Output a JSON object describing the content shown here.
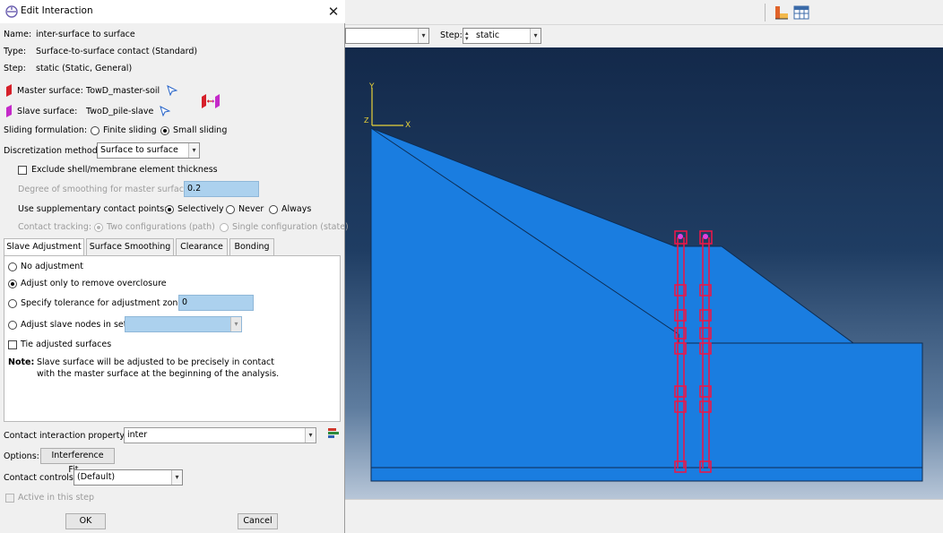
{
  "dialog": {
    "title": "Edit Interaction",
    "name_label": "Name:",
    "name_value": "inter-surface to surface",
    "type_label": "Type:",
    "type_value": "Surface-to-surface contact (Standard)",
    "step_label": "Step:",
    "step_value": "static (Static, General)",
    "master_label": "Master surface:",
    "master_value": "TowD_master-soil",
    "slave_label": "Slave surface:",
    "slave_value": "TwoD_pile-slave",
    "sliding_label": "Sliding formulation:",
    "sliding_options": [
      "Finite sliding",
      "Small sliding"
    ],
    "sliding_selected": "Small sliding",
    "disc_label": "Discretization method:",
    "disc_value": "Surface to surface",
    "exclude_label": "Exclude shell/membrane element thickness",
    "smoothing_label": "Degree of smoothing for master surface:",
    "smoothing_value": "0.2",
    "supp_label": "Use supplementary contact points:",
    "supp_options": [
      "Selectively",
      "Never",
      "Always"
    ],
    "supp_selected": "Selectively",
    "tracking_label": "Contact tracking:",
    "tracking_options": [
      "Two configurations (path)",
      "Single configuration (state)"
    ],
    "tabs": [
      "Slave Adjustment",
      "Surface Smoothing",
      "Clearance",
      "Bonding"
    ],
    "active_tab": "Slave Adjustment",
    "adjust_options": [
      "No adjustment",
      "Adjust only to remove overclosure",
      "Specify tolerance for adjustment zone:",
      "Adjust slave nodes in set:"
    ],
    "adjust_selected": "Adjust only to remove overclosure",
    "tolerance_value": "0",
    "tie_label": "Tie adjusted surfaces",
    "note_label": "Note:",
    "note_line1": "Slave surface will be adjusted to be precisely in contact",
    "note_line2": "with the master surface at the beginning of the analysis.",
    "property_label": "Contact interaction property:",
    "property_value": "inter",
    "options_label": "Options:",
    "interference_btn": "Interference Fit...",
    "controls_label": "Contact controls:",
    "controls_value": "(Default)",
    "active_label": "Active in this step",
    "ok": "OK",
    "cancel": "Cancel"
  },
  "app": {
    "step_label": "Step:",
    "step_value": "static",
    "axis_y": "Y",
    "axis_x": "X",
    "axis_z": "Z"
  }
}
